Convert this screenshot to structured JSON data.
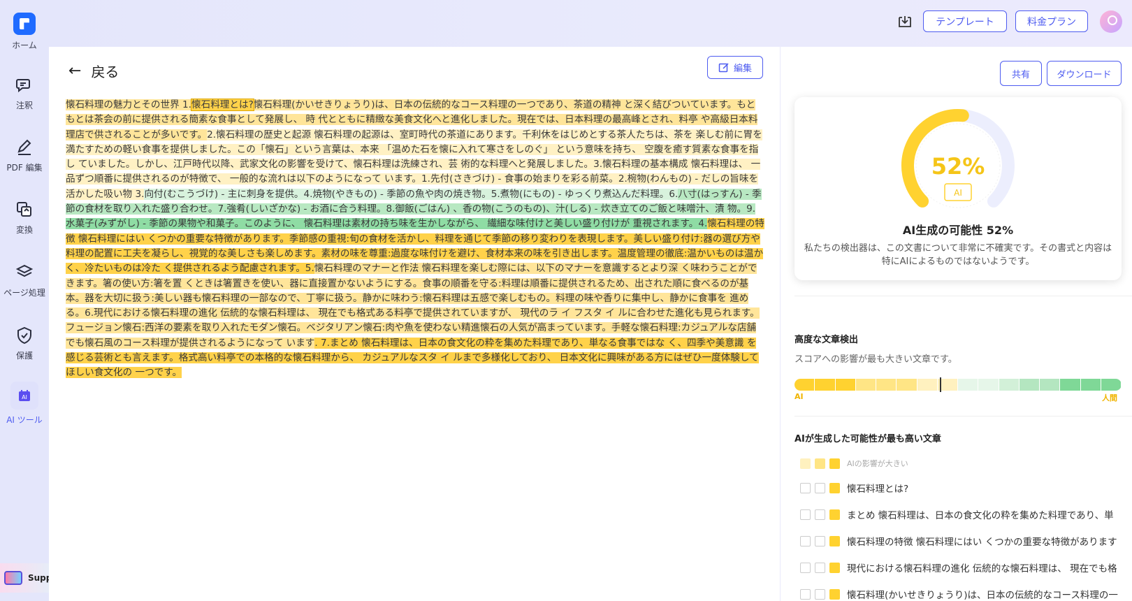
{
  "sidebar": {
    "items": [
      {
        "label": "ホーム"
      },
      {
        "label": "注釈"
      },
      {
        "label": "PDF 編集"
      },
      {
        "label": "変換"
      },
      {
        "label": "ページ処理"
      },
      {
        "label": "保護"
      },
      {
        "label": "AI ツール"
      }
    ],
    "support_label": "Support"
  },
  "header": {
    "template_label": "テンプレート",
    "pricing_label": "料金プラン"
  },
  "main": {
    "back_label": "戻る",
    "edit_label": "編集",
    "segments": [
      {
        "t": "懐石料理の魅力とその世界 1.",
        "c": "h2"
      },
      {
        "t": "懐石料理とは?",
        "c": "h1 hl-box"
      },
      {
        "t": "懐石料理(かいせきりょうり)は、日本の伝統的なコース料理の一つであり、茶道の精神 と深く結びついています。もともとは茶会の前に提供される簡素な食事として発展し、 時 代とともに精緻な美食文化へと進化しました。現在では、日本料理の最高峰とされ、料亭 や高級日本料理店で供されることが多いです。",
        "c": "h2"
      },
      {
        "t": "2.懐石料理の歴史と起源 懐石料理の起源は、室町時代の茶道にあります。千利休をはじめとする茶人たちは、茶を 楽しむ前に胃を満たすための軽い食事を提供しました。この「懐石」という言葉は、本来 「温めた石を懐に入れて寒さをしのぐ」 という意味を持ち、 空腹を癒す質素な食事を指し ていました。しかし、江戸時代以降、武家文化の影響を受けて、懐石料理は洗練され、芸 術的な料理へと発展しました。3.懐石料理の基本構成 懐石料理は、 一品ずつ順番に提供されるのが特徴で、 一般的な流れは以下のようになって います。1.先付(さきづけ) - 食事の始まりを彩る前菜。2.椀物(わんもの) - だしの旨味を活かした吸い物 3.",
        "c": "h3"
      },
      {
        "t": "向付(むこうづけ) - 主に刺身を提供。4.焼物(やきもの) - 季節の魚や肉の焼き物。5.煮物(にもの) - ゆっくり煮込んだ料理。6.",
        "c": "g1"
      },
      {
        "t": "八寸(はっすん) - 季節の食材を取り入れた盛り合わせ。7.強肴(しいざかな) - お酒に合う料理。8.御飯(ごはん) 、香の物(こうのもの)、汁(しる) - 炊き立てのご飯と味噌汁、漬 物。9.",
        "c": "g2"
      },
      {
        "t": "水菓子(みずがし) - 季節の果物や和菓子。このように、 懐石料理は素材の持ち味を生かしながら、 繊細な味付けと美しい盛り付けが 重視されます。4.",
        "c": "g3"
      },
      {
        "t": "懐石料理の特徴 懐石料理にはい くつかの重要な特徴があります。季節感の重視:旬の食材を活かし、料理を通じて季節の移り変わりを表現します。美しい盛り付け:器の選び方や料理の配置に工夫を凝らし、視覚的な美しさも楽しめます。素材の味を尊重:過度な味付けを避け、食材本来の味を引き出します。温度管理の徹底:温かいものは温か く、冷たいものは冷た く提供されるよう配慮されます。5.",
        "c": "h1"
      },
      {
        "t": "懐石料理のマナーと作法 懐石料理を楽しむ際には、以下のマナーを意識するとより深 く味わうことができます。箸の使い方:箸を置 くときは箸置きを使い、器に直接置かないようにする。食事の順番を守る:料理は順番に提供されるため、出された順に食べるのが基本。器を大切に扱う:美しい器も懐石料理の一部なので、丁寧に扱う。静かに味わう:懐石料理は五感で楽しむもの。料理の味や香りに集中し、静かに食事を 進める。6.現代における懐石料理の進化 伝統的な懐石料理は、 現在でも格式ある料亭で提供されていますが、 現代のラ イ フスタ イ ルに合わせた進化も見られます。フュージョン懐石:西洋の要素を取り入れたモダン懐石。ベジタリアン懐石:肉や魚を使わない精進懐石の人気が高まっています。手軽な懐石料理:カジュアルな店舗でも懐石風のコース料理が提供されるようになって います",
        "c": "h2"
      },
      {
        "t": ". 7.まとめ 懐石料理は、日本の食文化の粋を集めた料理であり、単なる食事ではな く、四季や美意識 を感じる芸術とも言えます。格式高い料亭での本格的な懐石料理から、 カジュアルなスタ イ ルまで多様化しており、 日本文化に興味がある方にはぜひ一度体験してほしい食文化の 一つです。",
        "c": "h1"
      }
    ]
  },
  "result": {
    "share_label": "共有",
    "download_label": "ダウンロード",
    "percent": 52,
    "percent_text": "52%",
    "badge": "AI",
    "title": "AI生成の可能性 52%",
    "description": "私たちの検出器は、この文書について非常に不確実です。その書式と内容は特にAIによるものではないようです。",
    "advanced_title": "高度な文章検出",
    "advanced_sub": "スコアへの影響が最も大きい文章です。",
    "scale_left": "AI",
    "scale_right": "人間",
    "scale_colors": [
      "#ffd230",
      "#ffd230",
      "#ffd230",
      "#ffe585",
      "#ffe585",
      "#ffe585",
      "#fff1bf",
      "#fff1bf",
      "#e6f6e9",
      "#e6f6e9",
      "#d2f0d8",
      "#b4e6c0",
      "#b4e6c0",
      "#7fd897",
      "#7fd897",
      "#7fd897"
    ],
    "top_title": "AIが生成した可能性が最も高い文章",
    "legend_label": "AIの影響が大きい",
    "sentences": [
      "懐石料理とは?",
      "まとめ 懐石料理は、日本の食文化の粋を集めた料理であり、単",
      "懐石料理の特徴 懐石料理にはい くつかの重要な特徴があります",
      "現代における懐石料理の進化 伝統的な懐石料理は、 現在でも格",
      "懐石料理(かいせきりょうり)は、日本の伝統的なコース料理の一"
    ]
  }
}
